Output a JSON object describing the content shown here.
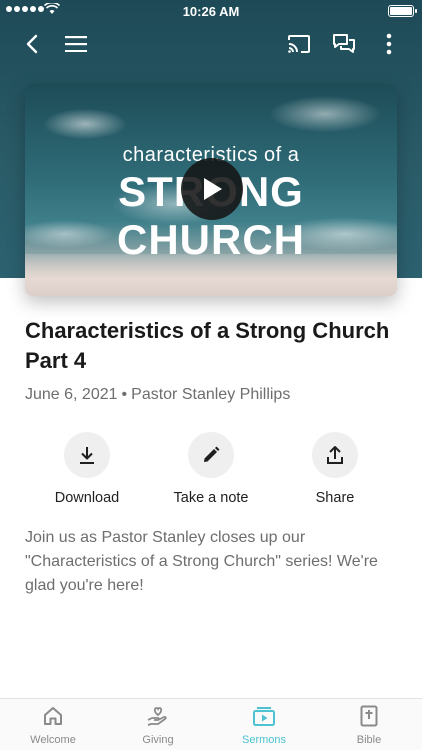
{
  "status_bar": {
    "time": "10:26 AM"
  },
  "nav": {
    "icons": [
      "back-icon",
      "menu-icon",
      "cast-icon",
      "chat-icon",
      "more-icon"
    ]
  },
  "hero": {
    "subtitle": "characteristics of a",
    "title": "STRONG CHURCH"
  },
  "sermon": {
    "title": "Characteristics of a Strong Church Part 4",
    "date": "June 6, 2021",
    "separator": "•",
    "speaker": "Pastor Stanley Phillips",
    "description": "Join us as Pastor Stanley closes up our \"Characteristics of a Strong Church\" series! We're glad you're here!"
  },
  "actions": {
    "download": "Download",
    "note": "Take a note",
    "share": "Share"
  },
  "tabs": {
    "welcome": "Welcome",
    "giving": "Giving",
    "sermons": "Sermons",
    "bible": "Bible",
    "active": "sermons",
    "active_color": "#4dc2d1"
  },
  "colors": {
    "header_bg": "#2a5c68",
    "accent": "#4dc2d1"
  }
}
